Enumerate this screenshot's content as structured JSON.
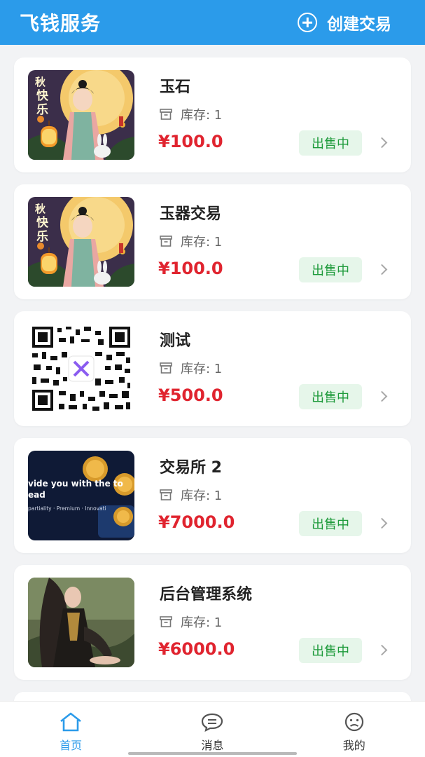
{
  "header": {
    "title": "飞钱服务",
    "create_label": "创建交易",
    "color": "#2b9bea"
  },
  "stock_label": "库存: 1",
  "status_label": "出售中",
  "items": [
    {
      "title": "玉石",
      "price": "¥100.0",
      "image": "mid-autumn-girl-lantern"
    },
    {
      "title": "玉器交易",
      "price": "¥100.0",
      "image": "mid-autumn-girl-lantern"
    },
    {
      "title": "测试",
      "price": "¥500.0",
      "image": "qr-code"
    },
    {
      "title": "交易所 2",
      "price": "¥7000.0",
      "image": "bitcoin-banner"
    },
    {
      "title": "后台管理系统",
      "price": "¥6000.0",
      "image": "character-portrait"
    }
  ],
  "thumb_text": {
    "festival_1": "秋",
    "festival_2": "快",
    "festival_3": "乐",
    "banner_line1": "vide you with the to",
    "banner_line2": "ead",
    "banner_line3": "partiality · Premium · Innovati"
  },
  "tabs": [
    {
      "label": "首页",
      "icon": "home-icon",
      "active": true
    },
    {
      "label": "消息",
      "icon": "message-icon",
      "active": false
    },
    {
      "label": "我的",
      "icon": "profile-icon",
      "active": false
    }
  ],
  "colors": {
    "price": "#e0242f",
    "badge_bg": "#e6f6ea",
    "badge_text": "#1f9b3c"
  }
}
